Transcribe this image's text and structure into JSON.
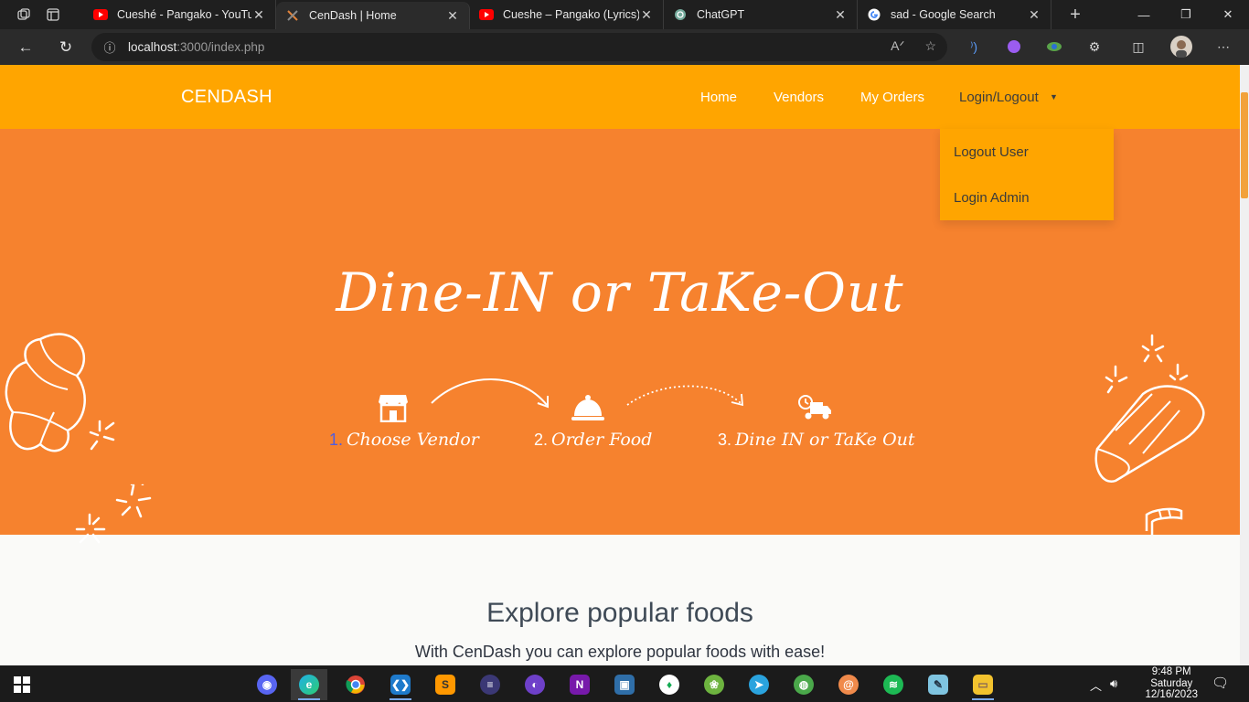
{
  "browser": {
    "tabs": [
      {
        "title": "Cueshé - Pangako - YouTube",
        "favicon": "youtube-icon",
        "active": false
      },
      {
        "title": "CenDash | Home",
        "favicon": "cendash-icon",
        "active": true
      },
      {
        "title": "Cueshe – Pangako (Lyrics) - YouTube",
        "favicon": "youtube-icon",
        "active": false
      },
      {
        "title": "ChatGPT",
        "favicon": "chatgpt-icon",
        "active": false
      },
      {
        "title": "sad - Google Search",
        "favicon": "google-icon",
        "active": false
      }
    ],
    "url_host": "localhost",
    "url_rest": ":3000/index.php"
  },
  "site": {
    "brand": "CENDASH",
    "nav": {
      "home": "Home",
      "vendors": "Vendors",
      "orders": "My Orders",
      "login": "Login/Logout"
    },
    "dropdown": {
      "logout_user": "Logout User",
      "login_admin": "Login Admin"
    },
    "hero": {
      "title": "Dine-IN or TaKe-Out",
      "steps": [
        {
          "num": "1.",
          "label": "Choose Vendor"
        },
        {
          "num": "2.",
          "label": "Order Food"
        },
        {
          "num": "3.",
          "label": "Dine IN or TaKe Out"
        }
      ]
    },
    "explore": {
      "title": "Explore popular foods",
      "subtitle": "With CenDash you can explore popular foods with ease!"
    }
  },
  "taskbar": {
    "time": "9:48 PM",
    "day": "Saturday",
    "date": "12/16/2023"
  },
  "colors": {
    "navbar": "#ffa500",
    "hero": "#f6822e",
    "step1_number": "#4f5de0"
  }
}
